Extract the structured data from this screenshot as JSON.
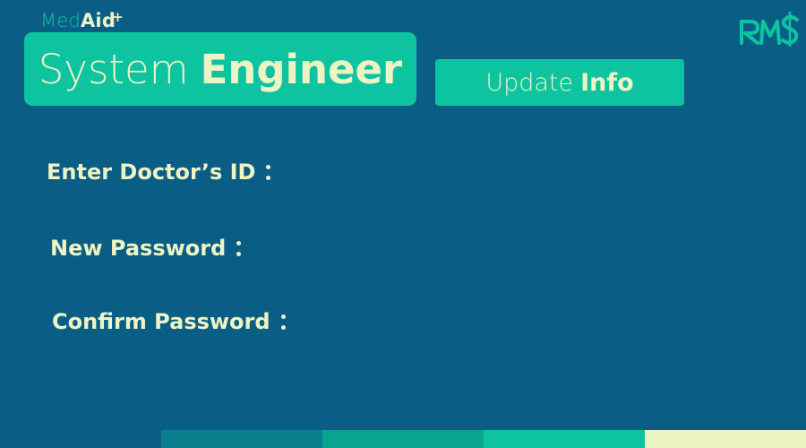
{
  "brand": {
    "logo_part1": "Med",
    "logo_part2": "Aid",
    "logo_plus": "+"
  },
  "header": {
    "role_light": "System",
    "role_bold": "Engineer",
    "update_light": "Update",
    "update_bold": "Info"
  },
  "form": {
    "fields": [
      {
        "label": "Enter Doctor’s ID",
        "value": ""
      },
      {
        "label": "New Password",
        "value": ""
      },
      {
        "label": "Confirm Password",
        "value": ""
      }
    ]
  },
  "corner_logo": {
    "icon": "rms-logo-icon"
  },
  "colors": {
    "background": "#0a5e86",
    "accent": "#0ec4a0",
    "text": "#eef3c4",
    "stripe_1": "#0a7f8d",
    "stripe_2": "#0aa291",
    "stripe_3": "#0ec4a0",
    "stripe_4": "#eef3c4"
  }
}
